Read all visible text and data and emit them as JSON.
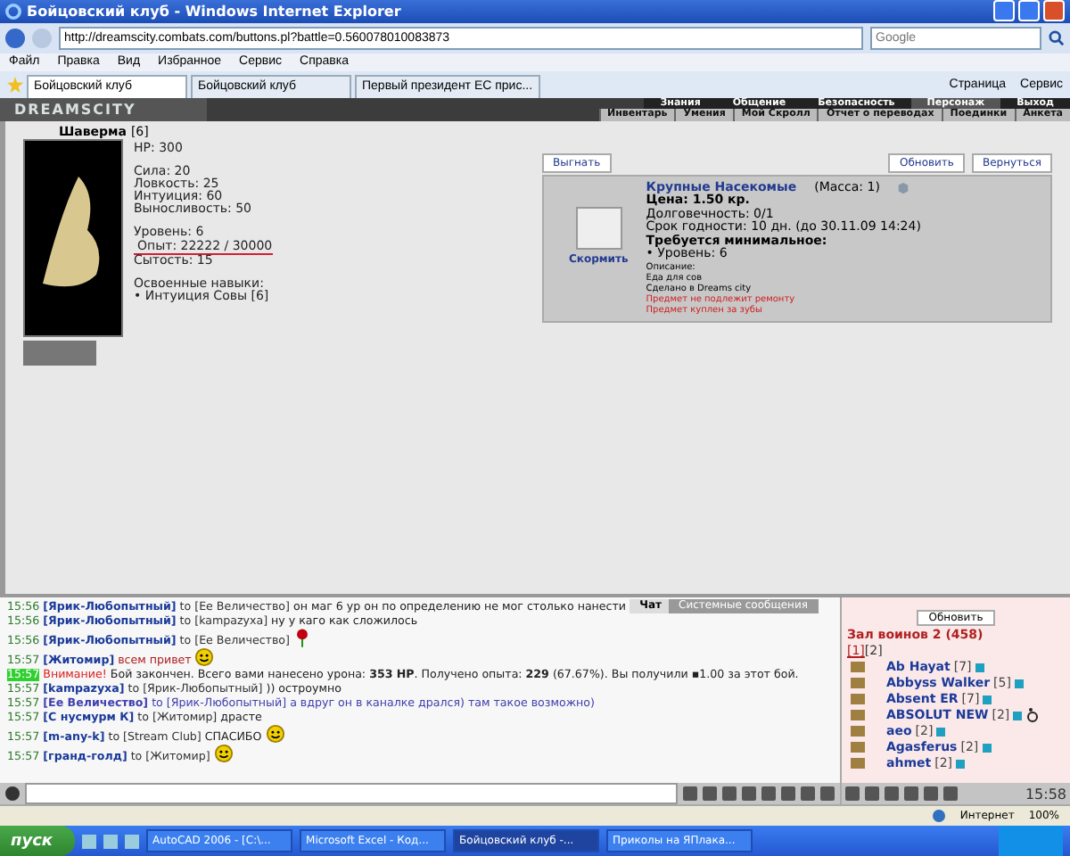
{
  "window": {
    "title": "Бойцовский клуб - Windows Internet Explorer"
  },
  "address_bar": {
    "url": "http://dreamscity.combats.com/buttons.pl?battle=0.560078010083873",
    "search_placeholder": "Google"
  },
  "menu": [
    "Файл",
    "Правка",
    "Вид",
    "Избранное",
    "Сервис",
    "Справка"
  ],
  "browser_tabs": [
    {
      "label": "Бойцовский клуб",
      "selected": true
    },
    {
      "label": "Бойцовский клуб",
      "selected": false
    },
    {
      "label": "Первый президент ЕС прис...",
      "selected": false
    }
  ],
  "command_bar": [
    "Страница",
    "Сервис"
  ],
  "game_nav": {
    "logo": "DREAMSCITY",
    "top": [
      {
        "label": "Знания",
        "selected": false
      },
      {
        "label": "Общение",
        "selected": false
      },
      {
        "label": "Безопасность",
        "selected": false
      },
      {
        "label": "Персонаж",
        "selected": true
      },
      {
        "label": "Выход",
        "selected": false
      }
    ],
    "sub": [
      "Инвентарь",
      "Умения",
      "Мой Скролл",
      "Отчет о переводах",
      "Поединки",
      "Анкета"
    ]
  },
  "pet": {
    "name": "Шаверма",
    "level": "[6]",
    "stat_groups": [
      [
        {
          "text": "HP: 300",
          "underlined": false
        }
      ],
      [
        {
          "text": "Сила: 20",
          "underlined": false
        },
        {
          "text": "Ловкость: 25",
          "underlined": false
        },
        {
          "text": "Интуиция: 60",
          "underlined": false
        },
        {
          "text": "Выносливость: 50",
          "underlined": false
        }
      ],
      [
        {
          "text": "Уровень: 6",
          "underlined": false
        },
        {
          "text": "Опыт: 22222 / 30000",
          "underlined": true
        },
        {
          "text": "Сытость: 15",
          "underlined": false
        }
      ],
      [
        {
          "text": "Освоенные навыки:",
          "underlined": false
        },
        {
          "text": "• Интуиция Совы [6]",
          "underlined": false
        }
      ]
    ]
  },
  "actions": {
    "left": [
      "Выгнать"
    ],
    "right": [
      "Обновить",
      "Вернуться"
    ]
  },
  "item": {
    "name": "Крупные Насекомые",
    "mass": "(Масса: 1)",
    "action": "Скормить",
    "lines": [
      {
        "kind": "bold",
        "text": "Цена: 1.50 кр."
      },
      {
        "kind": "normal",
        "text": "Долговечность: 0/1"
      },
      {
        "kind": "normal",
        "text": "Срок годности: 10 дн. (до 30.11.09 14:24)"
      },
      {
        "kind": "bold",
        "text": "Требуется минимальное:"
      },
      {
        "kind": "normal",
        "text": "• Уровень: 6"
      },
      {
        "kind": "small",
        "text": "Описание:"
      },
      {
        "kind": "small",
        "text": "Еда для сов"
      },
      {
        "kind": "small",
        "text": "Сделано в Dreams city"
      },
      {
        "kind": "warning",
        "text": "Предмет не подлежит ремонту"
      },
      {
        "kind": "warning",
        "text": "Предмет куплен за зубы"
      }
    ]
  },
  "chat": {
    "tabs": [
      {
        "label": "Чат",
        "selected": true
      },
      {
        "label": "Системные сообщения",
        "selected": false
      }
    ],
    "messages": [
      {
        "kind": "public",
        "time": "15:56",
        "sender": "[Ярик-Любопытный]",
        "recipient": "to [Ее Величество]",
        "text": "он маг 6 ур он по определению не мог столько нанести",
        "smiley": false,
        "rose": false
      },
      {
        "kind": "public",
        "time": "15:56",
        "sender": "[Ярик-Любопытный]",
        "recipient": "to [kampazyxa]",
        "text": "ну у каго как сложилось",
        "smiley": false,
        "rose": false
      },
      {
        "kind": "public",
        "time": "15:56",
        "sender": "[Ярик-Любопытный]",
        "recipient": "to [Ее Величество]",
        "smiley": false,
        "rose": true
      },
      {
        "kind": "greeting",
        "time": "15:57",
        "sender": "[Житомир]",
        "text": "всем привет",
        "smiley": true,
        "rose": false
      },
      {
        "kind": "system",
        "time": "15:57",
        "sender": "Внимание!",
        "text": "Бой закончен. Всего вами нанесено урона: **353 HP**. Получено опыта: **229** (67.67%). Вы получили ▪1.00 за этот бой.",
        "smiley": false,
        "rose": false
      },
      {
        "kind": "public",
        "time": "15:57",
        "sender": "[kampazyxa]",
        "recipient": "to [Ярик-Любопытный]",
        "text": ")) остроумно",
        "smiley": false,
        "rose": false
      },
      {
        "kind": "private",
        "time": "15:57",
        "sender": "[Ее Величество]",
        "recipient": "to [Ярик-Любопытный]",
        "text": "а вдруг он в каналке дрался) там такое возможно)",
        "smiley": false,
        "rose": false
      },
      {
        "kind": "public",
        "time": "15:57",
        "sender": "[С нусмурм К]",
        "recipient": "to [Житомир]",
        "text": "драсте",
        "smiley": false,
        "rose": false
      },
      {
        "kind": "public",
        "time": "15:57",
        "sender": "[m-any-k]",
        "recipient": "to [Stream Club]",
        "text": "СПАСИБО",
        "smiley": true,
        "rose": false
      },
      {
        "kind": "public",
        "time": "15:57",
        "sender": "[гранд-голд]",
        "recipient": "to [Житомир]",
        "smiley": true,
        "rose": false
      }
    ]
  },
  "users": {
    "refresh": "Обновить",
    "room": "Зал воинов 2 (458)",
    "pages": [
      {
        "label": "[1]",
        "selected": true
      },
      {
        "label": "[2]",
        "selected": false
      }
    ],
    "list": [
      {
        "name": "Ab Hayat",
        "level": "[7]",
        "injured": false
      },
      {
        "name": "Abbyss Walker",
        "level": "[5]",
        "injured": false
      },
      {
        "name": "Absent ER",
        "level": "[7]",
        "injured": false
      },
      {
        "name": "ABSOLUT NEW",
        "level": "[2]",
        "injured": true
      },
      {
        "name": "aeo",
        "level": "[2]",
        "injured": false
      },
      {
        "name": "Agasferus",
        "level": "[2]",
        "injured": false
      },
      {
        "name": "ahmet",
        "level": "[2]",
        "injured": false
      }
    ]
  },
  "game_clock": "15:58",
  "status_bar": {
    "zone": "Интернет",
    "zoom": "100%"
  },
  "taskbar": {
    "start": "пуск",
    "tasks": [
      {
        "label": "AutoCAD 2006 - [C:\\...",
        "selected": false
      },
      {
        "label": "Microsoft Excel - Код...",
        "selected": false
      },
      {
        "label": "Бойцовский клуб -...",
        "selected": true
      },
      {
        "label": "Приколы на ЯПлака...",
        "selected": false
      }
    ]
  }
}
